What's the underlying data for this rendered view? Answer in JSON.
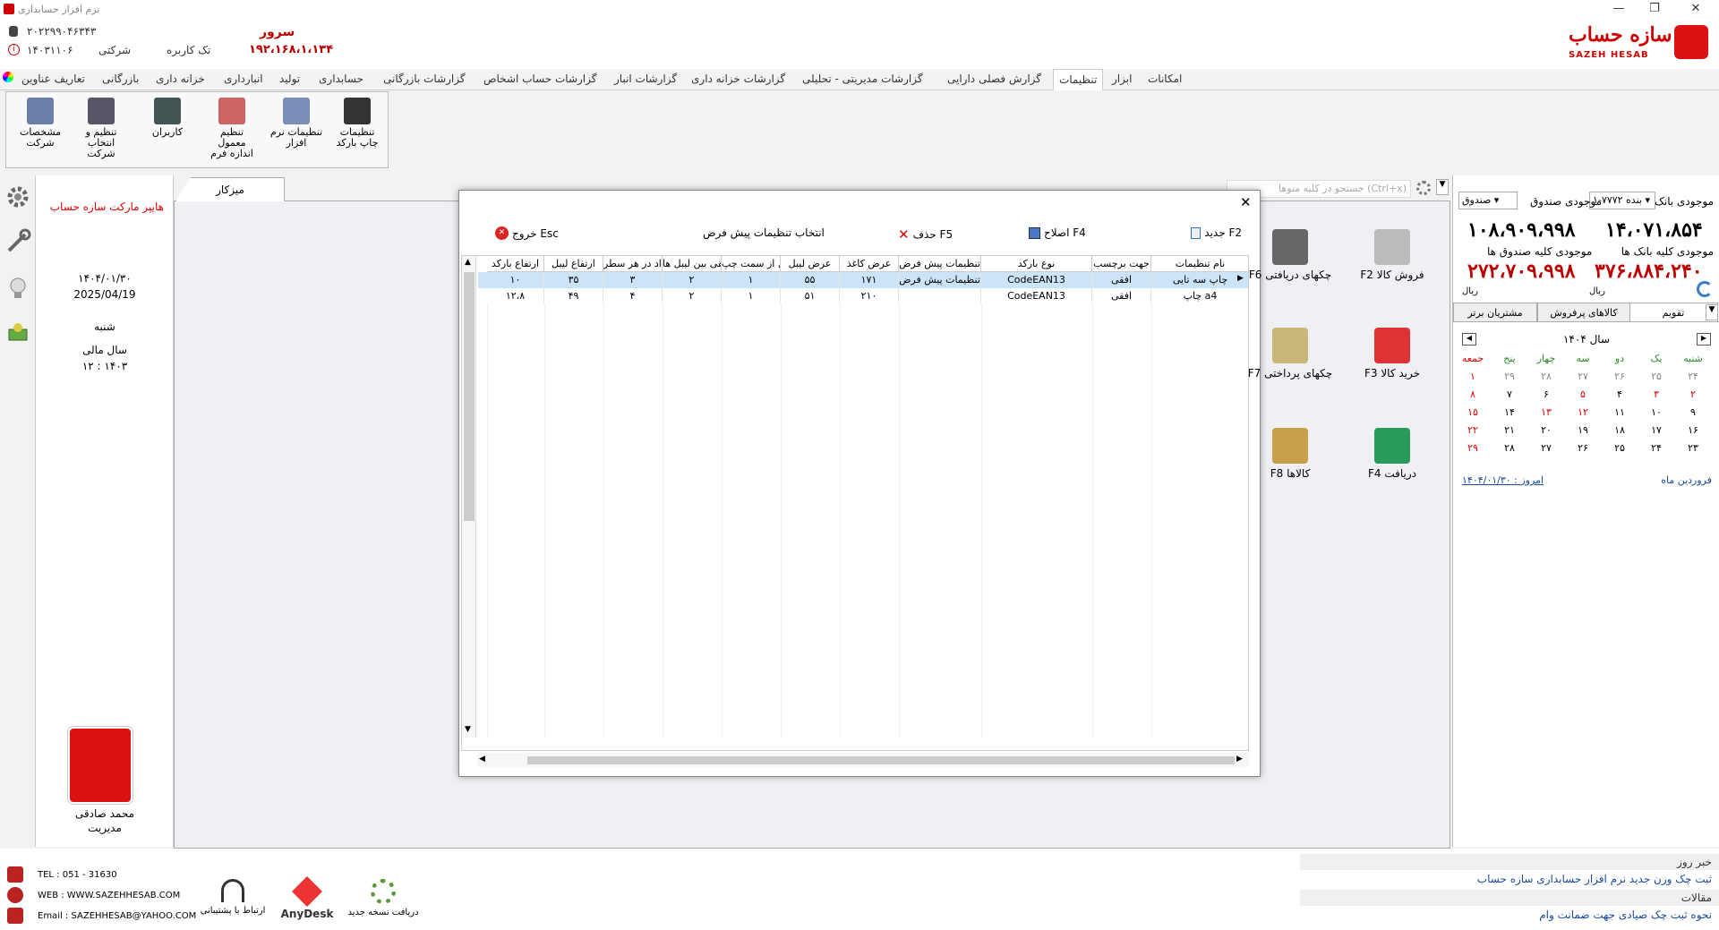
{
  "window": {
    "title": "نرم افزار حسابداری",
    "min": "—",
    "max": "❐",
    "close": "✕"
  },
  "header": {
    "phone_code": "۲۰۲۲۹۹۰۴۶۳۴۳",
    "date_code": "۱۴۰۳۱۱۰۶",
    "company_label": "شرکتی",
    "user_mode": "تک کاربره",
    "server_label": "سرور",
    "server_ip": "۱۹۲،۱۶۸،۱،۱۳۴",
    "logo_fa": "سازه حساب",
    "logo_en": "SAZEH HESAB"
  },
  "menu": [
    "امکانات",
    "ابزار",
    "تنظیمات",
    "گزارش فصلی دارایی",
    "گزارشات مدیریتی - تحلیلی",
    "گزارشات خزانه داری",
    "گزارشات انبار",
    "گزارشات حساب اشخاص",
    "گزارشات بازرگانی",
    "حسابداری",
    "تولید",
    "انبارداری",
    "خزانه داری",
    "بازرگانی",
    "تعاریف عناوین"
  ],
  "menu_active": "تنظیمات",
  "ribbon": [
    "تنظیمات چاپ بارکد",
    "تنظیمات نرم افزار",
    "تنظیم معمول اندازه فرم",
    "کاربران",
    "تنظیم و انتخاب شرکت",
    "مشخصات شرکت"
  ],
  "info": {
    "company": "هایپر مارکت سازه حساب",
    "date_fa": "۱۴۰۴/۰۱/۳۰",
    "date_en": "2025/04/19",
    "weekday": "شنبه",
    "fiscal_label": "سال مالی",
    "fiscal_value": "۱۲ : ۱۴۰۳",
    "user_name": "محمد صادقی",
    "user_role": "مدیریت"
  },
  "main": {
    "tab": "میزکار",
    "search_placeholder": "جستجو در کلیه منوها (Ctrl+x)"
  },
  "shortcuts": [
    {
      "label": "F2  فروش کالا",
      "color": "#bbb"
    },
    {
      "label": "F6  چکهای دریافتی",
      "color": "#666"
    },
    {
      "label": "F3  خرید کالا",
      "color": "#d33"
    },
    {
      "label": "F7  چکهای پرداختی",
      "color": "#c9b67a"
    },
    {
      "label": "F4  دریافت",
      "color": "#2a9a5a"
    },
    {
      "label": "F8  کالاها",
      "color": "#c9a04a"
    }
  ],
  "right": {
    "bank_label": "موجودی بانک",
    "bank_select": "بنده ۷۷۷۲-۱",
    "fund_label": "موجودی صندوق",
    "fund_select": "صندوق",
    "bank_value": "۱۴،۰۷۱،۸۵۴",
    "fund_value": "۱۰۸،۹۰۹،۹۹۸",
    "all_banks_label": "موجودی کلیه بانک ها",
    "all_funds_label": "موجودی کلیه صندوق ها",
    "all_banks_value": "۳۷۶،۸۸۴،۲۴۰",
    "all_funds_value": "۲۷۲،۷۰۹،۹۹۸",
    "currency": "ریال",
    "tabs": [
      "تقویم",
      "کالاهای پرفروش",
      "مشتریان برتر"
    ],
    "cal_year": "سال ۱۴۰۴",
    "weekdays": [
      "شنبه",
      "یک",
      "دو",
      "سه",
      "چهار",
      "پنج",
      "جمعه"
    ],
    "weeks": [
      [
        "۲۴",
        "۲۵",
        "۲۶",
        "۲۷",
        "۲۸",
        "۲۹",
        "۱"
      ],
      [
        "۲",
        "۳",
        "۴",
        "۵",
        "۶",
        "۷",
        "۸"
      ],
      [
        "۹",
        "۱۰",
        "۱۱",
        "۱۲",
        "۱۳",
        "۱۴",
        "۱۵"
      ],
      [
        "۱۶",
        "۱۷",
        "۱۸",
        "۱۹",
        "۲۰",
        "۲۱",
        "۲۲"
      ],
      [
        "۲۳",
        "۲۴",
        "۲۵",
        "۲۶",
        "۲۷",
        "۲۸",
        "۲۹"
      ]
    ],
    "month": "فروردین ماه",
    "today": "امروز : ۱۴۰۴/۰۱/۳۰"
  },
  "dialog": {
    "toolbar": {
      "new": "جدید F2",
      "edit": "اصلاح F4",
      "delete": "حذف F5",
      "default": "انتخاب تنظیمات پیش فرض",
      "exit": "خروج Esc"
    },
    "columns": [
      "نام تنظیمات",
      "جهت برچسب",
      "نوع بارکد",
      "تنظیمات پیش فرض",
      "عرض کاغذ",
      "عرض لیبل",
      "فاصله لیبل از سمت چپ",
      "فاصله افقی بین لیبل ها",
      "تعداد در هر سطر",
      "ارتفاع لیبل",
      "ارتفاع بارکد"
    ],
    "rows": [
      [
        "چاپ سه تایی",
        "افقی",
        "CodeEAN13",
        "تنظیمات پیش فرض",
        "۱۷۱",
        "۵۵",
        "۱",
        "۲",
        "۳",
        "۳۵",
        "۱۰"
      ],
      [
        "چاپ a4",
        "افقی",
        "CodeEAN13",
        "",
        "۲۱۰",
        "۵۱",
        "۱",
        "۲",
        "۴",
        "۴۹",
        "۱۲،۸"
      ]
    ]
  },
  "footer": {
    "tel": "TEL : 051 - 31630",
    "web": "WEB : WWW.SAZEHHESAB.COM",
    "email": "Email : SAZEHHESAB@YAHOO.COM",
    "support": "ارتباط با پشتیبانی",
    "anydesk": "AnyDesk",
    "update": "دریافت نسخه جدید",
    "news_title": "خبر روز",
    "news_item": "ثبت چک وزن جدید نرم افزار حسابداری سازه حساب",
    "articles_title": "مقالات",
    "article_item": "نحوه ثبت چک صیادی جهت ضمانت وام"
  }
}
